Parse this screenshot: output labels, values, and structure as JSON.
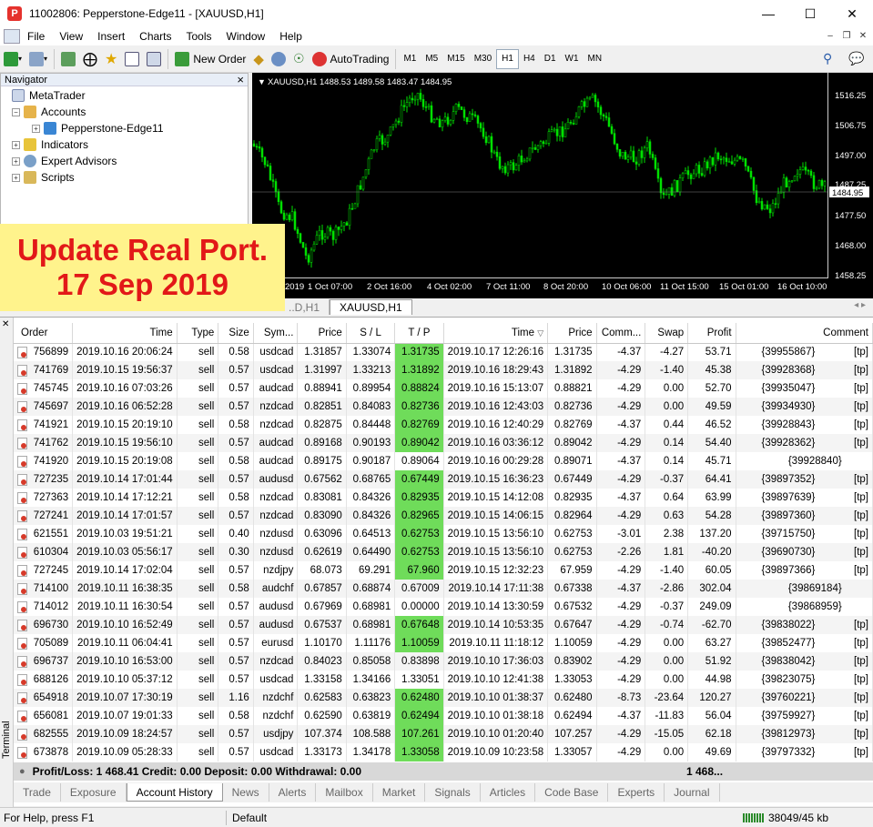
{
  "window": {
    "title": "11002806: Pepperstone-Edge11 - [XAUUSD,H1]",
    "logo_letter": "P"
  },
  "menu": [
    "File",
    "View",
    "Insert",
    "Charts",
    "Tools",
    "Window",
    "Help"
  ],
  "toolbar": {
    "new_order": "New Order",
    "autotrading": "AutoTrading",
    "timeframes": [
      "M1",
      "M5",
      "M15",
      "M30",
      "H1",
      "H4",
      "D1",
      "W1",
      "MN"
    ],
    "active_tf": "H1"
  },
  "navigator": {
    "title": "Navigator",
    "close": "×",
    "items": [
      "MetaTrader",
      "Accounts",
      "Pepperstone-Edge11",
      "Indicators",
      "Expert Advisors",
      "Scripts"
    ]
  },
  "banner": {
    "line1": "Update Real Port.",
    "line2": "17 Sep 2019"
  },
  "chart": {
    "header": "XAUUSD,H1  1488.53 1489.58 1483.47 1484.95",
    "price_labels": [
      "1516.25",
      "1506.75",
      "1497.00",
      "1487.25",
      "1477.50",
      "1468.00",
      "1458.25"
    ],
    "current_price": "1484.95",
    "time_labels": [
      "1 Oct 07:00",
      "2 Oct 16:00",
      "4 Oct 02:00",
      "7 Oct 11:00",
      "8 Oct 20:00",
      "10 Oct 06:00",
      "11 Oct 15:00",
      "15 Oct 01:00",
      "16 Oct 10:00"
    ],
    "first_date_fragment": "2019",
    "color_candle": "#00e000",
    "color_bg": "#000000"
  },
  "chart_tabs": [
    "..D,H1",
    "XAUUSD,H1"
  ],
  "chart_tab_arrows": "◂ ▸",
  "table": {
    "columns": [
      "Order",
      "Time",
      "Type",
      "Size",
      "Sym...",
      "Price",
      "S / L",
      "T / P",
      "Time",
      "Price",
      "Comm...",
      "Swap",
      "Profit",
      "Comment"
    ],
    "time_sort_arrow": "▽",
    "rows": [
      {
        "order": "756899",
        "time": "2019.10.16 20:06:24",
        "type": "sell",
        "size": "0.58",
        "sym": "usdcad",
        "price": "1.31857",
        "sl": "1.33074",
        "tp": "1.31735",
        "tp_hit": true,
        "ctime": "2019.10.17 12:26:16",
        "cprice": "1.31735",
        "comm": "-4.37",
        "swap": "-4.27",
        "profit": "53.71",
        "comment": "{39955867}",
        "tag": "[tp]"
      },
      {
        "order": "741769",
        "time": "2019.10.15 19:56:37",
        "type": "sell",
        "size": "0.57",
        "sym": "usdcad",
        "price": "1.31997",
        "sl": "1.33213",
        "tp": "1.31892",
        "tp_hit": true,
        "ctime": "2019.10.16 18:29:43",
        "cprice": "1.31892",
        "comm": "-4.29",
        "swap": "-1.40",
        "profit": "45.38",
        "comment": "{39928368}",
        "tag": "[tp]"
      },
      {
        "order": "745745",
        "time": "2019.10.16 07:03:26",
        "type": "sell",
        "size": "0.57",
        "sym": "audcad",
        "price": "0.88941",
        "sl": "0.89954",
        "tp": "0.88824",
        "tp_hit": true,
        "ctime": "2019.10.16 15:13:07",
        "cprice": "0.88821",
        "comm": "-4.29",
        "swap": "0.00",
        "profit": "52.70",
        "comment": "{39935047}",
        "tag": "[tp]"
      },
      {
        "order": "745697",
        "time": "2019.10.16 06:52:28",
        "type": "sell",
        "size": "0.57",
        "sym": "nzdcad",
        "price": "0.82851",
        "sl": "0.84083",
        "tp": "0.82736",
        "tp_hit": true,
        "ctime": "2019.10.16 12:43:03",
        "cprice": "0.82736",
        "comm": "-4.29",
        "swap": "0.00",
        "profit": "49.59",
        "comment": "{39934930}",
        "tag": "[tp]"
      },
      {
        "order": "741921",
        "time": "2019.10.15 20:19:10",
        "type": "sell",
        "size": "0.58",
        "sym": "nzdcad",
        "price": "0.82875",
        "sl": "0.84448",
        "tp": "0.82769",
        "tp_hit": true,
        "ctime": "2019.10.16 12:40:29",
        "cprice": "0.82769",
        "comm": "-4.37",
        "swap": "0.44",
        "profit": "46.52",
        "comment": "{39928843}",
        "tag": "[tp]"
      },
      {
        "order": "741762",
        "time": "2019.10.15 19:56:10",
        "type": "sell",
        "size": "0.57",
        "sym": "audcad",
        "price": "0.89168",
        "sl": "0.90193",
        "tp": "0.89042",
        "tp_hit": true,
        "ctime": "2019.10.16 03:36:12",
        "cprice": "0.89042",
        "comm": "-4.29",
        "swap": "0.14",
        "profit": "54.40",
        "comment": "{39928362}",
        "tag": "[tp]"
      },
      {
        "order": "741920",
        "time": "2019.10.15 20:19:08",
        "type": "sell",
        "size": "0.58",
        "sym": "audcad",
        "price": "0.89175",
        "sl": "0.90187",
        "tp": "0.89064",
        "tp_hit": false,
        "ctime": "2019.10.16 00:29:28",
        "cprice": "0.89071",
        "comm": "-4.37",
        "swap": "0.14",
        "profit": "45.71",
        "comment": "{39928840}",
        "tag": ""
      },
      {
        "order": "727235",
        "time": "2019.10.14 17:01:44",
        "type": "sell",
        "size": "0.57",
        "sym": "audusd",
        "price": "0.67562",
        "sl": "0.68765",
        "tp": "0.67449",
        "tp_hit": true,
        "ctime": "2019.10.15 16:36:23",
        "cprice": "0.67449",
        "comm": "-4.29",
        "swap": "-0.37",
        "profit": "64.41",
        "comment": "{39897352}",
        "tag": "[tp]"
      },
      {
        "order": "727363",
        "time": "2019.10.14 17:12:21",
        "type": "sell",
        "size": "0.58",
        "sym": "nzdcad",
        "price": "0.83081",
        "sl": "0.84326",
        "tp": "0.82935",
        "tp_hit": true,
        "ctime": "2019.10.15 14:12:08",
        "cprice": "0.82935",
        "comm": "-4.37",
        "swap": "0.64",
        "profit": "63.99",
        "comment": "{39897639}",
        "tag": "[tp]"
      },
      {
        "order": "727241",
        "time": "2019.10.14 17:01:57",
        "type": "sell",
        "size": "0.57",
        "sym": "nzdcad",
        "price": "0.83090",
        "sl": "0.84326",
        "tp": "0.82965",
        "tp_hit": true,
        "ctime": "2019.10.15 14:06:15",
        "cprice": "0.82964",
        "comm": "-4.29",
        "swap": "0.63",
        "profit": "54.28",
        "comment": "{39897360}",
        "tag": "[tp]"
      },
      {
        "order": "621551",
        "time": "2019.10.03 19:51:21",
        "type": "sell",
        "size": "0.40",
        "sym": "nzdusd",
        "price": "0.63096",
        "sl": "0.64513",
        "tp": "0.62753",
        "tp_hit": true,
        "ctime": "2019.10.15 13:56:10",
        "cprice": "0.62753",
        "comm": "-3.01",
        "swap": "2.38",
        "profit": "137.20",
        "comment": "{39715750}",
        "tag": "[tp]"
      },
      {
        "order": "610304",
        "time": "2019.10.03 05:56:17",
        "type": "sell",
        "size": "0.30",
        "sym": "nzdusd",
        "price": "0.62619",
        "sl": "0.64490",
        "tp": "0.62753",
        "tp_hit": true,
        "ctime": "2019.10.15 13:56:10",
        "cprice": "0.62753",
        "comm": "-2.26",
        "swap": "1.81",
        "profit": "-40.20",
        "comment": "{39690730}",
        "tag": "[tp]"
      },
      {
        "order": "727245",
        "time": "2019.10.14 17:02:04",
        "type": "sell",
        "size": "0.57",
        "sym": "nzdjpy",
        "price": "68.073",
        "sl": "69.291",
        "tp": "67.960",
        "tp_hit": true,
        "ctime": "2019.10.15 12:32:23",
        "cprice": "67.959",
        "comm": "-4.29",
        "swap": "-1.40",
        "profit": "60.05",
        "comment": "{39897366}",
        "tag": "[tp]"
      },
      {
        "order": "714100",
        "time": "2019.10.11 16:38:35",
        "type": "sell",
        "size": "0.58",
        "sym": "audchf",
        "price": "0.67857",
        "sl": "0.68874",
        "tp": "0.67009",
        "tp_hit": false,
        "ctime": "2019.10.14 17:11:38",
        "cprice": "0.67338",
        "comm": "-4.37",
        "swap": "-2.86",
        "profit": "302.04",
        "comment": "{39869184}",
        "tag": ""
      },
      {
        "order": "714012",
        "time": "2019.10.11 16:30:54",
        "type": "sell",
        "size": "0.57",
        "sym": "audusd",
        "price": "0.67969",
        "sl": "0.68981",
        "tp": "0.00000",
        "tp_hit": false,
        "ctime": "2019.10.14 13:30:59",
        "cprice": "0.67532",
        "comm": "-4.29",
        "swap": "-0.37",
        "profit": "249.09",
        "comment": "{39868959}",
        "tag": ""
      },
      {
        "order": "696730",
        "time": "2019.10.10 16:52:49",
        "type": "sell",
        "size": "0.57",
        "sym": "audusd",
        "price": "0.67537",
        "sl": "0.68981",
        "tp": "0.67648",
        "tp_hit": true,
        "ctime": "2019.10.14 10:53:35",
        "cprice": "0.67647",
        "comm": "-4.29",
        "swap": "-0.74",
        "profit": "-62.70",
        "comment": "{39838022}",
        "tag": "[tp]"
      },
      {
        "order": "705089",
        "time": "2019.10.11 06:04:41",
        "type": "sell",
        "size": "0.57",
        "sym": "eurusd",
        "price": "1.10170",
        "sl": "1.11176",
        "tp": "1.10059",
        "tp_hit": true,
        "ctime": "2019.10.11 11:18:12",
        "cprice": "1.10059",
        "comm": "-4.29",
        "swap": "0.00",
        "profit": "63.27",
        "comment": "{39852477}",
        "tag": "[tp]"
      },
      {
        "order": "696737",
        "time": "2019.10.10 16:53:00",
        "type": "sell",
        "size": "0.57",
        "sym": "nzdcad",
        "price": "0.84023",
        "sl": "0.85058",
        "tp": "0.83898",
        "tp_hit": false,
        "ctime": "2019.10.10 17:36:03",
        "cprice": "0.83902",
        "comm": "-4.29",
        "swap": "0.00",
        "profit": "51.92",
        "comment": "{39838042}",
        "tag": "[tp]"
      },
      {
        "order": "688126",
        "time": "2019.10.10 05:37:12",
        "type": "sell",
        "size": "0.57",
        "sym": "usdcad",
        "price": "1.33158",
        "sl": "1.34166",
        "tp": "1.33051",
        "tp_hit": false,
        "ctime": "2019.10.10 12:41:38",
        "cprice": "1.33053",
        "comm": "-4.29",
        "swap": "0.00",
        "profit": "44.98",
        "comment": "{39823075}",
        "tag": "[tp]"
      },
      {
        "order": "654918",
        "time": "2019.10.07 17:30:19",
        "type": "sell",
        "size": "1.16",
        "sym": "nzdchf",
        "price": "0.62583",
        "sl": "0.63823",
        "tp": "0.62480",
        "tp_hit": true,
        "ctime": "2019.10.10 01:38:37",
        "cprice": "0.62480",
        "comm": "-8.73",
        "swap": "-23.64",
        "profit": "120.27",
        "comment": "{39760221}",
        "tag": "[tp]"
      },
      {
        "order": "656081",
        "time": "2019.10.07 19:01:33",
        "type": "sell",
        "size": "0.58",
        "sym": "nzdchf",
        "price": "0.62590",
        "sl": "0.63819",
        "tp": "0.62494",
        "tp_hit": true,
        "ctime": "2019.10.10 01:38:18",
        "cprice": "0.62494",
        "comm": "-4.37",
        "swap": "-11.83",
        "profit": "56.04",
        "comment": "{39759927}",
        "tag": "[tp]"
      },
      {
        "order": "682555",
        "time": "2019.10.09 18:24:57",
        "type": "sell",
        "size": "0.57",
        "sym": "usdjpy",
        "price": "107.374",
        "sl": "108.588",
        "tp": "107.261",
        "tp_hit": true,
        "ctime": "2019.10.10 01:20:40",
        "cprice": "107.257",
        "comm": "-4.29",
        "swap": "-15.05",
        "profit": "62.18",
        "comment": "{39812973}",
        "tag": "[tp]"
      },
      {
        "order": "673878",
        "time": "2019.10.09 05:28:33",
        "type": "sell",
        "size": "0.57",
        "sym": "usdcad",
        "price": "1.33173",
        "sl": "1.34178",
        "tp": "1.33058",
        "tp_hit": true,
        "ctime": "2019.10.09 10:23:58",
        "cprice": "1.33057",
        "comm": "-4.29",
        "swap": "0.00",
        "profit": "49.69",
        "comment": "{39797332}",
        "tag": "[tp]"
      }
    ]
  },
  "summary": {
    "text": "Profit/Loss: 1 468.41  Credit: 0.00  Deposit: 0.00  Withdrawal: 0.00",
    "total": "1 468..."
  },
  "terminal_label": "Terminal",
  "bottom_tabs": [
    "Trade",
    "Exposure",
    "Account History",
    "News",
    "Alerts",
    "Mailbox",
    "Market",
    "Signals",
    "Articles",
    "Code Base",
    "Experts",
    "Journal"
  ],
  "active_bottom_tab": "Account History",
  "status": {
    "help": "For Help, press F1",
    "profile": "Default",
    "traffic": "38049/45 kb"
  },
  "colors": {
    "tp_hit": "#6fdc5a",
    "banner_bg": "#fff38c",
    "banner_text": "#e21818"
  }
}
